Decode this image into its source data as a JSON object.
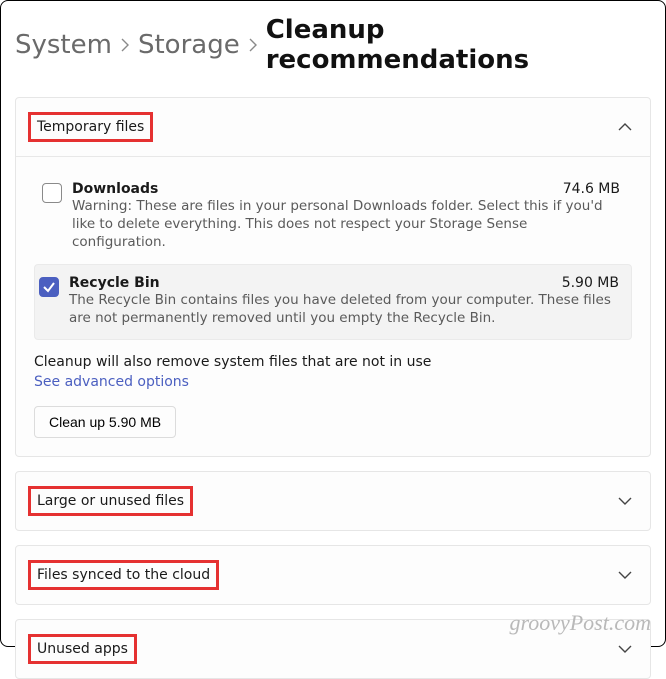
{
  "breadcrumb": {
    "system": "System",
    "storage": "Storage",
    "current": "Cleanup recommendations"
  },
  "sections": {
    "temporary": {
      "title": "Temporary files",
      "downloads": {
        "title": "Downloads",
        "size": "74.6 MB",
        "desc": "Warning: These are files in your personal Downloads folder. Select this if you'd like to delete everything. This does not respect your Storage Sense configuration."
      },
      "recycle": {
        "title": "Recycle Bin",
        "size": "5.90 MB",
        "desc": "The Recycle Bin contains files you have deleted from your computer. These files are not permanently removed until you empty the Recycle Bin."
      },
      "note": "Cleanup will also remove system files that are not in use",
      "link": "See advanced options",
      "button": "Clean up 5.90 MB"
    },
    "large": {
      "title": "Large or unused files"
    },
    "synced": {
      "title": "Files synced to the cloud"
    },
    "unused": {
      "title": "Unused apps"
    }
  },
  "watermark": "groovyPost.com"
}
